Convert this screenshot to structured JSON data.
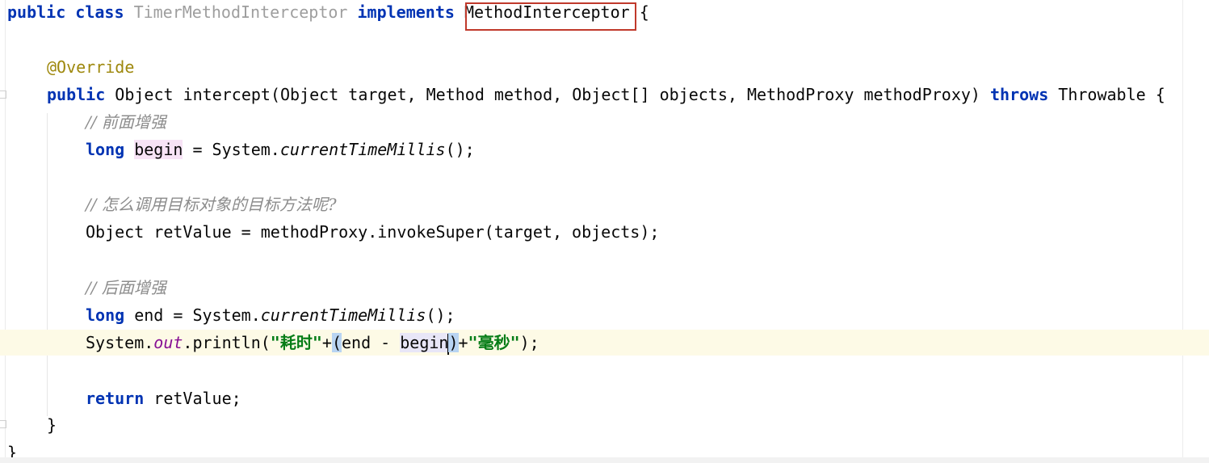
{
  "editor": {
    "language": "Java",
    "highlight_box_color": "#c0392b",
    "colors": {
      "keyword": "#0033b3",
      "annotation": "#9e880d",
      "comment": "#8c8c8c",
      "string": "#067d17",
      "static_field": "#871094",
      "current_line": "#fdfae6"
    },
    "lines": {
      "l1": {
        "kw_public": "public",
        "kw_class": "class",
        "class_name": "TimerMethodInterceptor",
        "kw_implements": "implements",
        "interface_name": "MethodInterceptor",
        "brace": "{"
      },
      "l2": {
        "annotation": "@Override"
      },
      "l3": {
        "kw_public": "public",
        "text1": "Object intercept(Object target, Method method, Object[] objects, MethodProxy methodProxy)",
        "kw_throws": "throws",
        "text2": "Throwable {"
      },
      "l4": {
        "comment": "// 前面增强"
      },
      "l5": {
        "kw_long": "long",
        "var": "begin",
        "text1": " = System.",
        "method": "currentTimeMillis",
        "text2": "();"
      },
      "l6": {
        "comment": "// 怎么调用目标对象的目标方法呢?"
      },
      "l7": {
        "text": "Object retValue = methodProxy.invokeSuper(target, objects);"
      },
      "l8": {
        "comment": "// 后面增强"
      },
      "l9": {
        "kw_long": "long",
        "text1": " end = System.",
        "method": "currentTimeMillis",
        "text2": "();"
      },
      "l10": {
        "text1": "System.",
        "field": "out",
        "text2": ".println(",
        "str1": "\"耗时\"",
        "plus1": "+",
        "paren_open": "(",
        "text3": "end - ",
        "var_begin_a": "begi",
        "var_begin_b": "n",
        "paren_close": ")",
        "plus2": "+",
        "str2": "\"毫秒\"",
        "text4": ");"
      },
      "l11": {
        "kw_return": "return",
        "text": " retValue;"
      },
      "l12": {
        "brace": "}"
      },
      "l13": {
        "brace": "}"
      }
    }
  }
}
